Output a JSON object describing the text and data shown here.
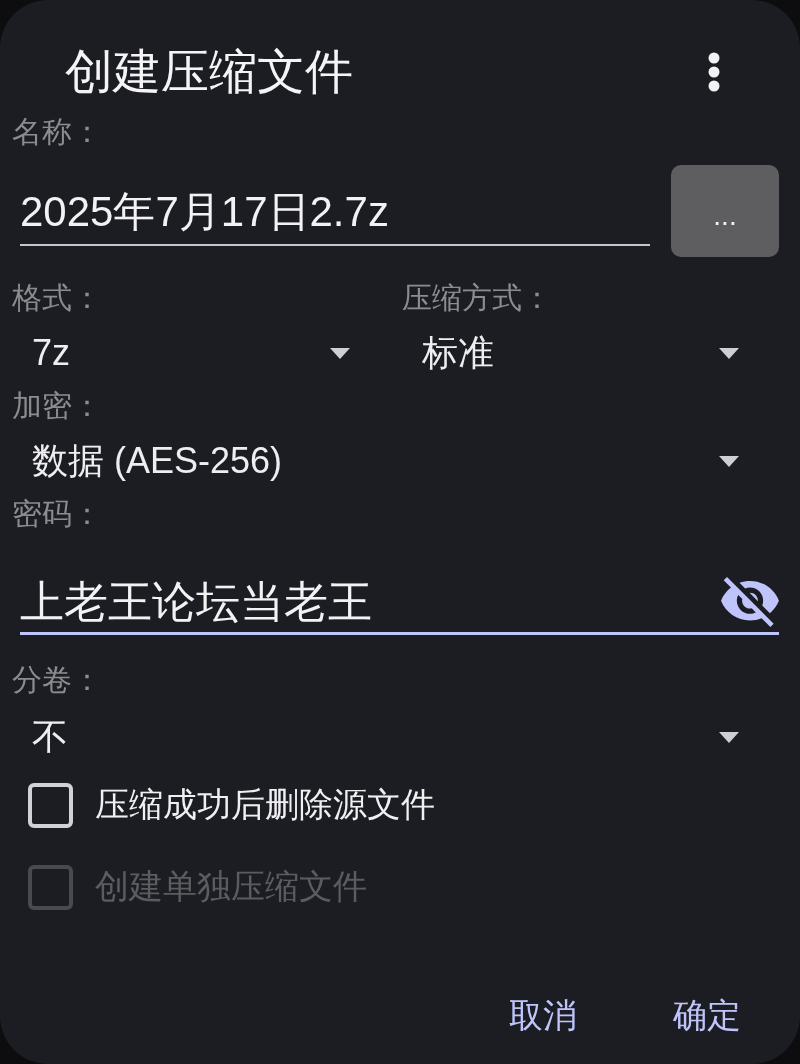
{
  "dialog": {
    "title": "创建压缩文件"
  },
  "name": {
    "label": "名称：",
    "value": "2025年7月17日2.7z",
    "browse_button": "..."
  },
  "format": {
    "label": "格式：",
    "value": "7z"
  },
  "compression": {
    "label": "压缩方式：",
    "value": "标准"
  },
  "encryption": {
    "label": "加密：",
    "value": "数据 (AES-256)"
  },
  "password": {
    "label": "密码：",
    "value": "上老王论坛当老王",
    "focused": true,
    "visible": true
  },
  "split": {
    "label": "分卷：",
    "value": "不"
  },
  "checkboxes": [
    {
      "label": "压缩成功后删除源文件",
      "checked": false,
      "disabled": false
    },
    {
      "label": "创建单独压缩文件",
      "checked": false,
      "disabled": true
    }
  ],
  "buttons": [
    "取消",
    "确定"
  ]
}
